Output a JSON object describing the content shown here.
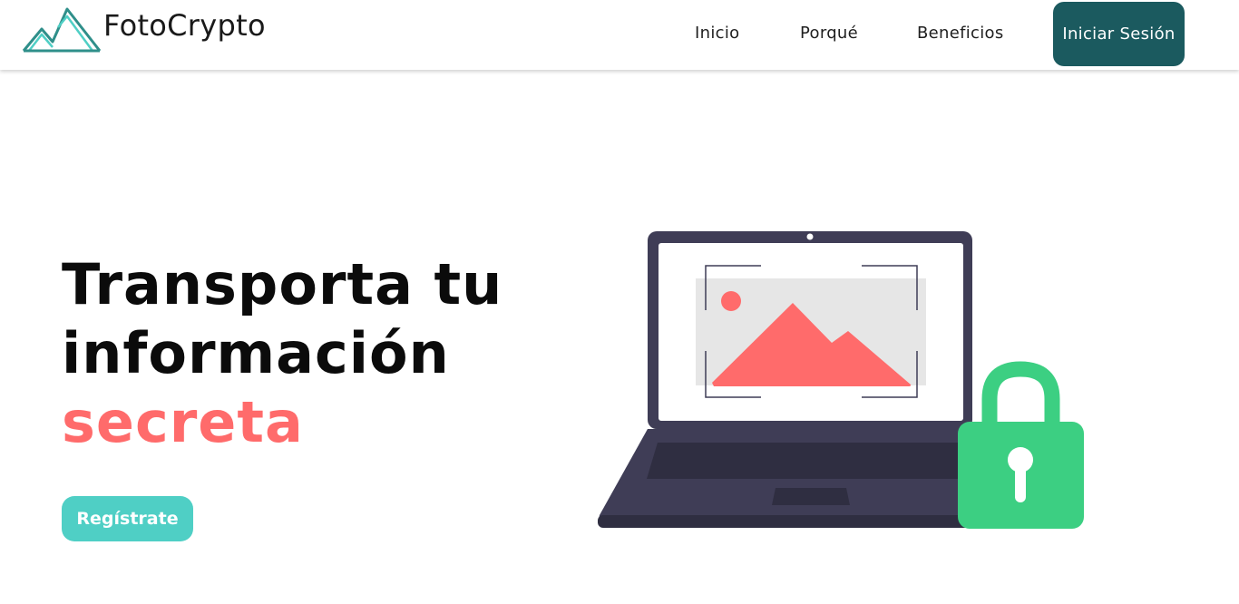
{
  "header": {
    "brand": "FotoCrypto",
    "logo_icon": "mountain-logo-icon",
    "nav": [
      {
        "label": "Inicio"
      },
      {
        "label": "Porqué"
      },
      {
        "label": "Beneficios"
      }
    ],
    "login_label": "Iniciar Sesión"
  },
  "hero": {
    "title_line1": "Transporta tu",
    "title_line2": "información",
    "title_accent": "secreta",
    "cta_label": "Regístrate"
  },
  "illustration": {
    "icons": [
      "laptop-icon",
      "image-icon",
      "padlock-icon"
    ]
  },
  "colors": {
    "brand_dark": "#1b5a5f",
    "accent_coral": "#ff6b6b",
    "cta_teal": "#4fcfc5",
    "lock_green": "#3ccf82",
    "laptop_dark": "#3f3d56"
  }
}
